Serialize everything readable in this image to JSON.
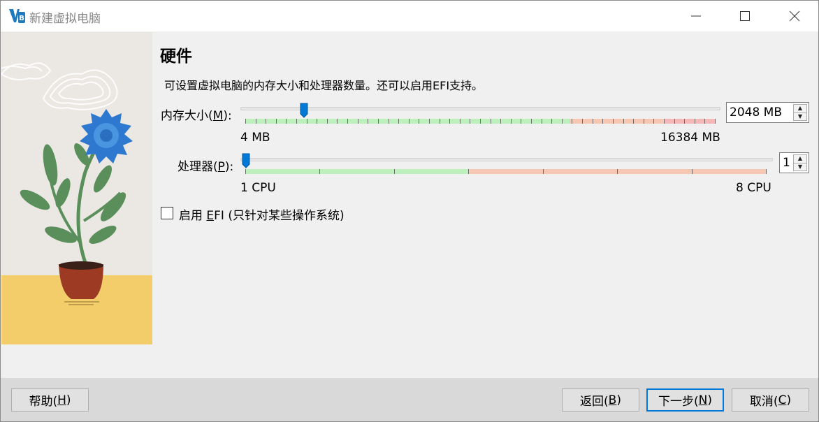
{
  "window": {
    "title": "新建虚拟电脑",
    "controls": {
      "minimize": "minimize",
      "maximize": "maximize",
      "close": "close"
    }
  },
  "page": {
    "heading": "硬件",
    "description": "可设置虚拟电脑的内存大小和处理器数量。还可以启用EFI支持。"
  },
  "memory": {
    "label_prefix": "内存大小(",
    "label_accel": "M",
    "label_suffix": "):",
    "value": "2048 MB",
    "min_label": "4 MB",
    "max_label": "16384 MB",
    "min_mb": 4,
    "max_mb": 16384,
    "current_mb": 2048
  },
  "processor": {
    "label_prefix": "处理器(",
    "label_accel": "P",
    "label_suffix": "):",
    "value": "1",
    "min_label": "1 CPU",
    "max_label": "8 CPU",
    "current": 1
  },
  "efi": {
    "label_prefix": "启用 ",
    "label_accel": "E",
    "label_suffix": "FI (只针对某些操作系统)",
    "checked": false
  },
  "footer": {
    "help": {
      "prefix": "帮助(",
      "accel": "H",
      "suffix": ")"
    },
    "back": {
      "prefix": "返回(",
      "accel": "B",
      "suffix": ")"
    },
    "next": {
      "prefix": "下一步(",
      "accel": "N",
      "suffix": ")"
    },
    "cancel": {
      "prefix": "取消(",
      "accel": "C",
      "suffix": ")"
    }
  },
  "colors": {
    "accent": "#0078d7",
    "range_ok": "#bdf0bd",
    "range_warn": "#f6c8b4",
    "range_bad": "#f5b8b8"
  }
}
